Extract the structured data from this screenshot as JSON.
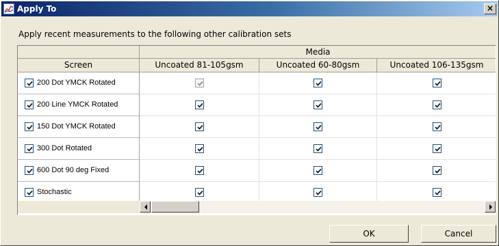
{
  "window": {
    "title": "Apply To",
    "close_glyph": "×"
  },
  "instruction": "Apply recent measurements to the following other calibration sets",
  "grid": {
    "group_header": "Media",
    "row_header_label": "Screen",
    "columns": [
      "Uncoated 81-105gsm",
      "Uncoated 60-80gsm",
      "Uncoated 106-135gsm"
    ],
    "rows": [
      {
        "label": "200 Dot YMCK Rotated",
        "selected": true,
        "cells": [
          {
            "checked": true,
            "enabled": false
          },
          {
            "checked": true,
            "enabled": true
          },
          {
            "checked": true,
            "enabled": true
          }
        ]
      },
      {
        "label": "200 Line YMCK Rotated",
        "selected": true,
        "cells": [
          {
            "checked": true,
            "enabled": true
          },
          {
            "checked": true,
            "enabled": true
          },
          {
            "checked": true,
            "enabled": true
          }
        ]
      },
      {
        "label": "150 Dot YMCK Rotated",
        "selected": true,
        "cells": [
          {
            "checked": true,
            "enabled": true
          },
          {
            "checked": true,
            "enabled": true
          },
          {
            "checked": true,
            "enabled": true
          }
        ]
      },
      {
        "label": "300 Dot Rotated",
        "selected": true,
        "cells": [
          {
            "checked": true,
            "enabled": true
          },
          {
            "checked": true,
            "enabled": true
          },
          {
            "checked": true,
            "enabled": true
          }
        ]
      },
      {
        "label": "600 Dot 90 deg Fixed",
        "selected": true,
        "cells": [
          {
            "checked": true,
            "enabled": true
          },
          {
            "checked": true,
            "enabled": true
          },
          {
            "checked": true,
            "enabled": true
          }
        ]
      },
      {
        "label": "Stochastic",
        "selected": true,
        "cells": [
          {
            "checked": true,
            "enabled": true
          },
          {
            "checked": true,
            "enabled": true
          },
          {
            "checked": true,
            "enabled": true
          }
        ]
      }
    ]
  },
  "buttons": {
    "ok": "OK",
    "cancel": "Cancel"
  },
  "icons": {
    "app": "app-icon",
    "close": "close-icon",
    "check": "check-icon",
    "scroll_left": "arrow-left-icon",
    "scroll_right": "arrow-right-icon"
  },
  "colors": {
    "title_gradient_start": "#0a246a",
    "title_gradient_end": "#a6caf0",
    "dialog_bg": "#ece9d8",
    "grid_bg": "#ffffff",
    "checkbox_border": "#1c5180"
  }
}
